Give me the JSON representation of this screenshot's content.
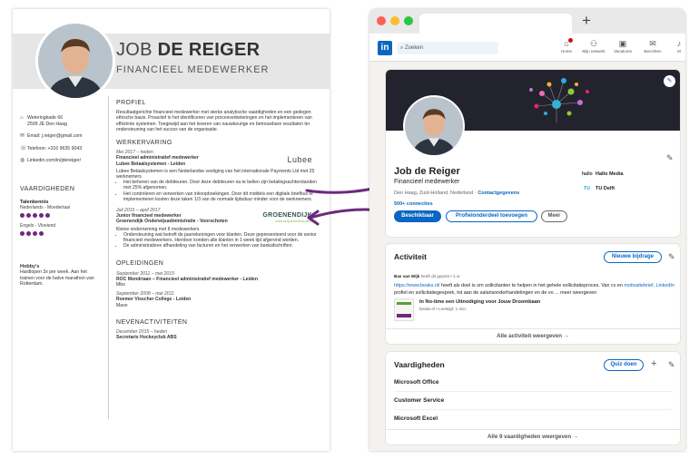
{
  "cv": {
    "name_first": "JOB ",
    "name_last": "DE REIGER",
    "role": "FINANCIEEL MEDEWERKER",
    "contact": [
      {
        "icon": "home-icon",
        "glyph": "⌂",
        "text": "Weteringkade 66\n2509 JE Den Haag"
      },
      {
        "icon": "mail-icon",
        "glyph": "✉",
        "text": "Email: j.reiger@gmail.com"
      },
      {
        "icon": "phone-icon",
        "glyph": "☏",
        "text": "Telefoon: +316 9635 9043"
      },
      {
        "icon": "linkedin-icon",
        "glyph": "◍",
        "text": "Linkedin.com/in/jdereiger/"
      }
    ],
    "skills_title": "VAARDIGHEDEN",
    "languages": [
      {
        "name": "Talenkennis",
        "level": "Nederlands - Moedertaal",
        "dots": 5
      },
      {
        "name": "",
        "level": "Engels - Vloeiend",
        "dots": 4
      }
    ],
    "hobby_title": "Hobby's",
    "hobby_text": "Hardlopen 3x per week. Aan het trainen voor de halve marathon van Rotterdam.",
    "profile_title": "PROFIEL",
    "profile_text": "Resultaatgerichte financieel medewerker met sterke analytische vaardigheden en een gedegen ethische basis. Proactief in het identificeren van procesverbeteringen en het implementeren van efficiënte systemen. Toegewijd aan het leveren van nauwkeurige en betrouwbare resultaten ter ondersteuning van het succes van de organisatie.",
    "work_title": "WERKERVARING",
    "jobs": [
      {
        "date": "Mei 2017 – heden",
        "title": "Financieel administratief medewerker",
        "company": "Lubee Betaalsystemen - Leiden",
        "logo": "Lubee",
        "desc": "Lubee Betaalsystemen is een Nederlandse vestiging van het internationale Payments Ltd met 25 werknemers",
        "bullets": [
          "Het beheren van de debiteuren. Door deze debiteuren na te bellen zijn betalingsachterstanden met 25% afgenomen.",
          "Het controleren en verwerken van inkoopboekingen. Door dit middels een digitale briefbus te implementeren kosten deze taken 1/3 van de normale tijdsduur minder voor de werknemers."
        ]
      },
      {
        "date": "Juli 2015 – april 2017",
        "title": "Junior financieel medewerker",
        "company": "Groenendijk Onderwijsadministratie - Voorschoten",
        "logo": "GROENENDIJK",
        "logo_sub": "onderwijsadministratie",
        "desc": "Kleine onderneming met 8 medewerkers",
        "bullets": [
          "Ondersteuning wat betreft de jaarrekeningen voor klanten. Deze gepresenteerd voor de senior financieel medewerkers. Hierdoor konden alle klanten in 1 week tijd afgerond worden.",
          "De administratieve afhandeling van facturen en het verwerken van bankafschriften."
        ]
      }
    ],
    "edu_title": "OPLEIDINGEN",
    "education": [
      {
        "date": "September 2011 – mei 2015",
        "title": "ROC Mondriaan – Financieel administratief medewerker - Leiden",
        "level": "Mbo"
      },
      {
        "date": "September 2008 – mei 2011",
        "title": "Roemer Visscher College - Leiden",
        "level": "Mavo"
      }
    ],
    "side_title": "NEVENACTIVITEITEN",
    "side": [
      {
        "date": "December 2015 – heden",
        "title": "Secretaris Hockeyclub ABS"
      }
    ]
  },
  "browser": {
    "new_tab": "+",
    "search_placeholder": "Zoeken",
    "nav": [
      {
        "icon": "home-icon",
        "glyph": "⌂",
        "label": "Home"
      },
      {
        "icon": "network-icon",
        "glyph": "⚇",
        "label": "Mijn netwerk"
      },
      {
        "icon": "briefcase-icon",
        "glyph": "▣",
        "label": "Vacatures"
      },
      {
        "icon": "message-icon",
        "glyph": "✉",
        "label": "Berichten"
      },
      {
        "icon": "notification-icon",
        "glyph": "♪",
        "label": "M"
      }
    ]
  },
  "profile": {
    "name": "Job de Reiger",
    "headline": "Financieel medewerker",
    "location": "Den Haag, Zuid-Holland, Nederland · ",
    "contact_link": "Contactgegevens",
    "connections": "500+ connecties",
    "btn_available": "Beschikbaar",
    "btn_add_section": "Profielonderdeel toevoegen",
    "btn_more": "Meer",
    "orgs": [
      {
        "mark": "hallo",
        "name": "Hallo Media"
      },
      {
        "mark": "TU",
        "name": "TU Delft"
      }
    ]
  },
  "activity": {
    "title": "Activiteit",
    "new_post": "Nieuwe bijdrage",
    "author": "Bas van Wijk",
    "meta": " heeft dit gepost • 1 w",
    "text_link1": "https://www.beaks.nl/",
    "text1": " heeft als doel is om sollicitanten te helpen in het gehele sollicitatieproces. Van cv en ",
    "text_link2": "motivatiebrief, LinkedIn",
    "text2": " profiel en sollicitatiegesprek, tot aan de salarisonderhandelingen en de vo ... meer weergeven",
    "article_title": "In No-time een Uitnodiging voor Jouw Droombaan",
    "article_sub": "beaks.nl • Leestijd: 1 min.",
    "show_all": "Alle activiteit weergeven →"
  },
  "skills": {
    "title": "Vaardigheden",
    "quiz": "Quiz doen",
    "items": [
      "Microsoft Office",
      "Customer Service",
      "Microsoft Excel"
    ],
    "show_all": "Alle 9 vaardigheden weergeven →"
  },
  "colors": {
    "linkedin_blue": "#0a66c2",
    "arrow_purple": "#6c2a7e",
    "cover_dark": "#23232d"
  }
}
